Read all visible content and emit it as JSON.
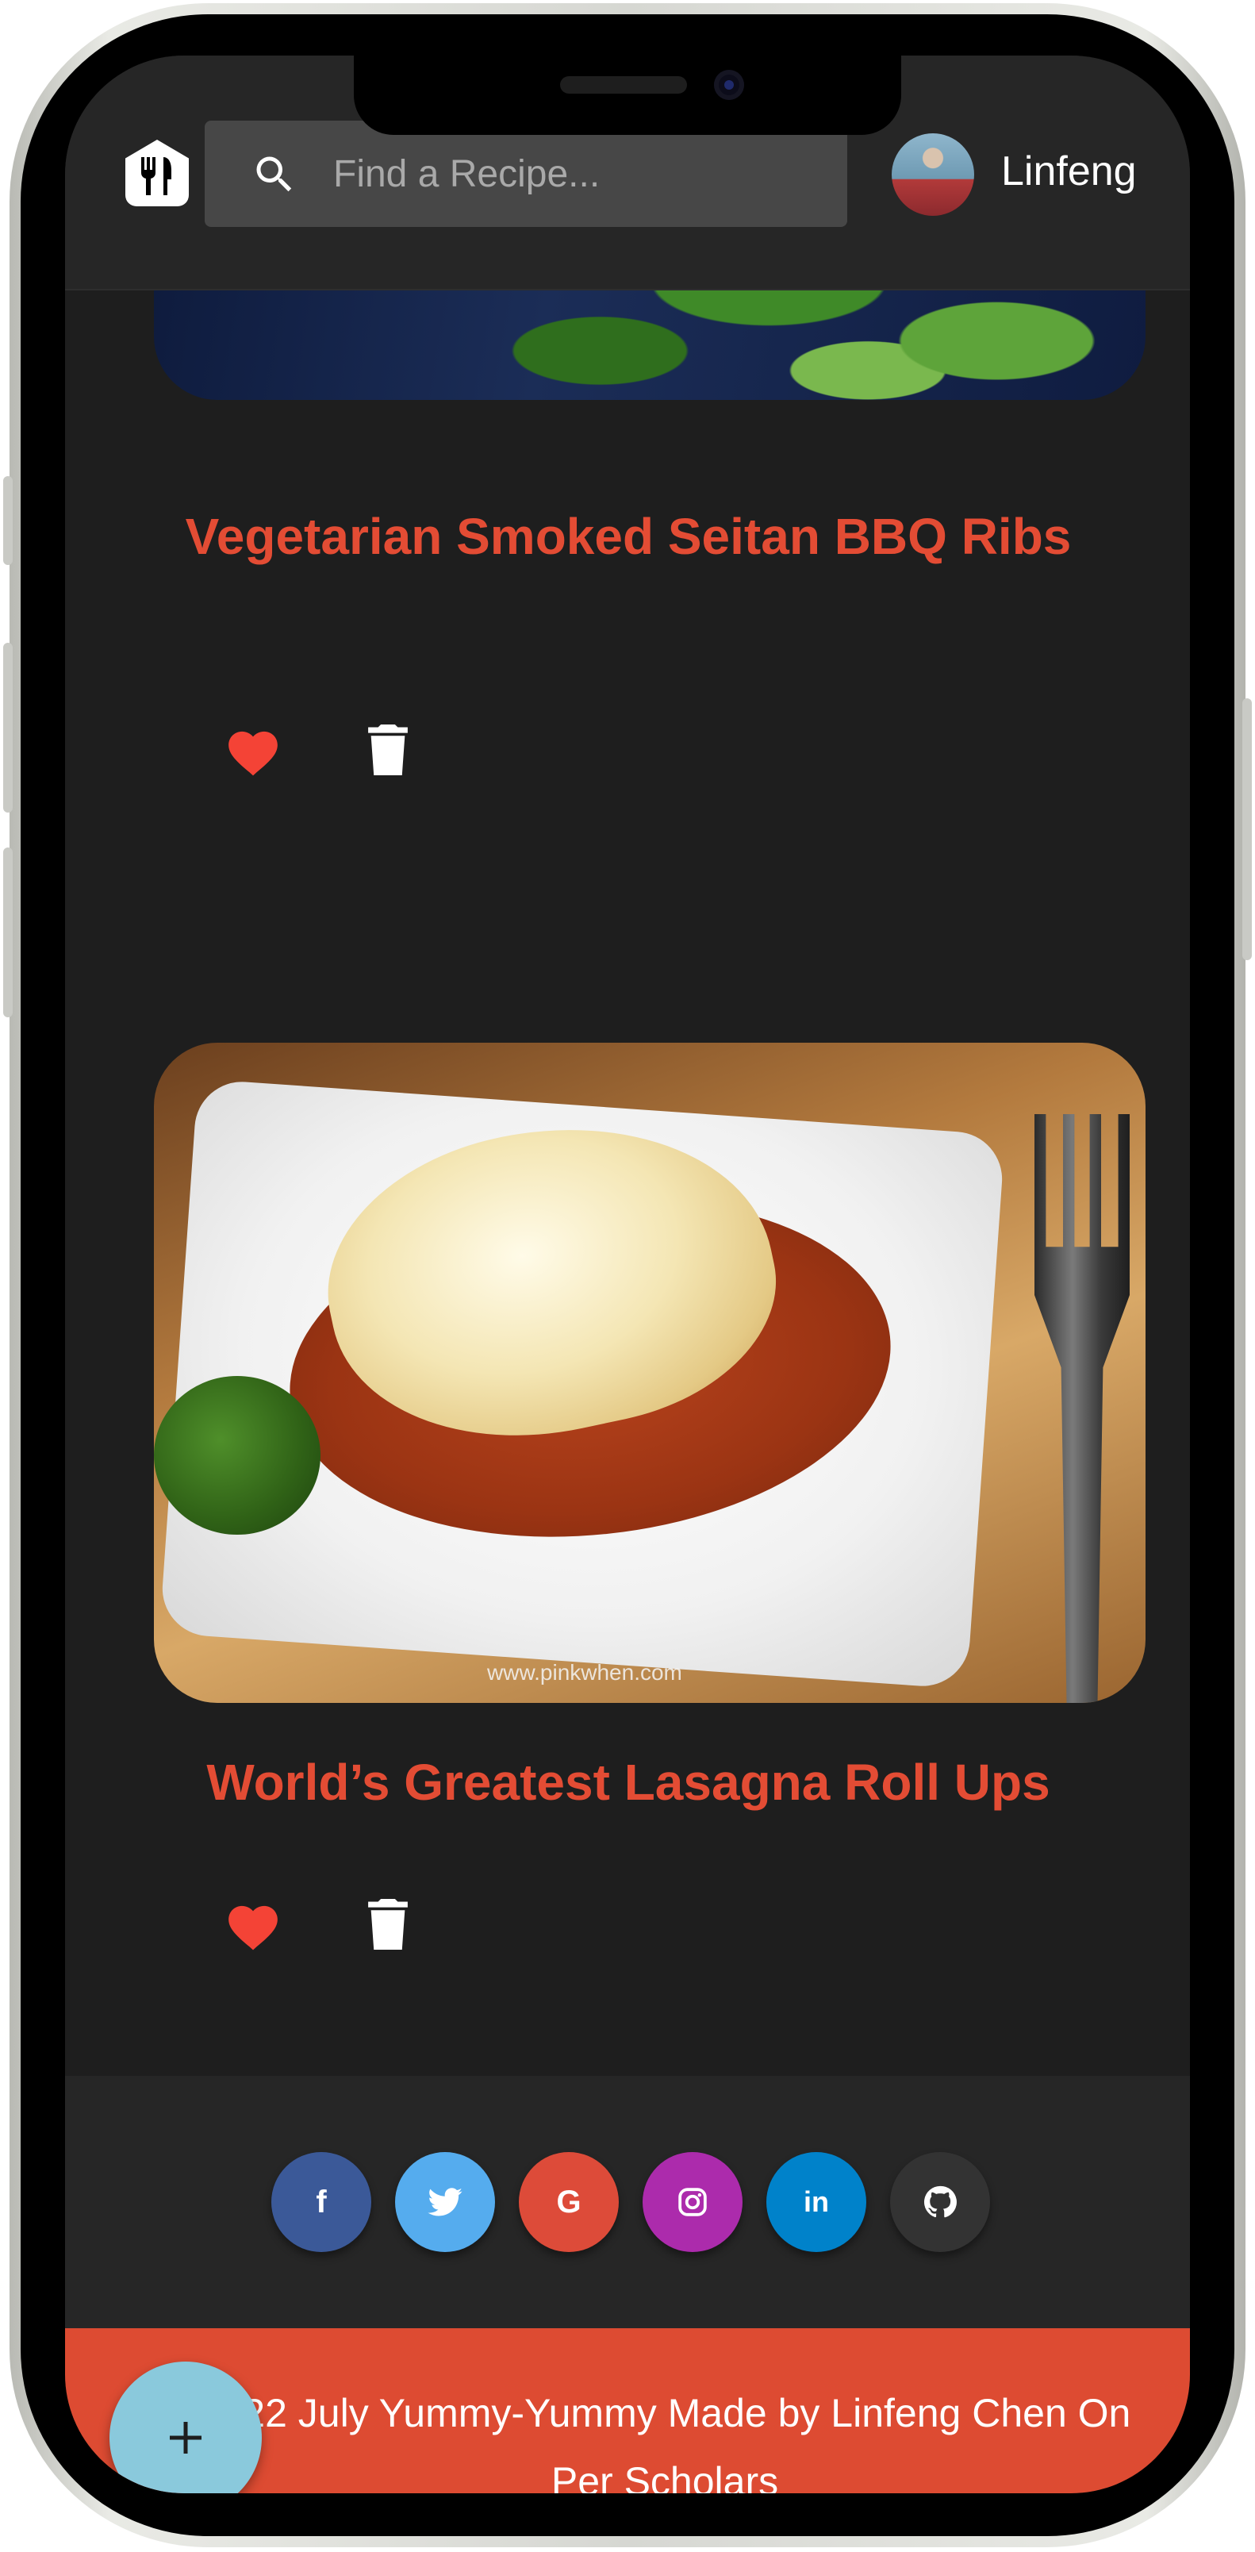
{
  "header": {
    "search_placeholder": "Find a Recipe...",
    "user_name": "Linfeng"
  },
  "recipes": [
    {
      "title": "Vegetarian Smoked Seitan BBQ Ribs"
    },
    {
      "title": "World’s Greatest Lasagna Roll Ups",
      "image_watermark": "www.pinkwhen.com"
    }
  ],
  "social": [
    {
      "name": "facebook",
      "glyph": "f",
      "color": "#3b5998"
    },
    {
      "name": "twitter",
      "glyph": "t",
      "color": "#55acee"
    },
    {
      "name": "google",
      "glyph": "G",
      "color": "#dd4b39"
    },
    {
      "name": "instagram",
      "glyph": "◎",
      "color": "#ac2bac"
    },
    {
      "name": "linkedin",
      "glyph": "in",
      "color": "#0082ca"
    },
    {
      "name": "github",
      "glyph": "●",
      "color": "#333333"
    }
  ],
  "footer": {
    "text": "2022 July Yummy-Yummy Made by Linfeng Chen On Per Scholars"
  },
  "fab": {
    "label": "+"
  },
  "colors": {
    "accent": "#e34c34",
    "footer_bg": "#dd4b32",
    "fab_bg": "#8ac9dc",
    "heart": "#f44336"
  }
}
